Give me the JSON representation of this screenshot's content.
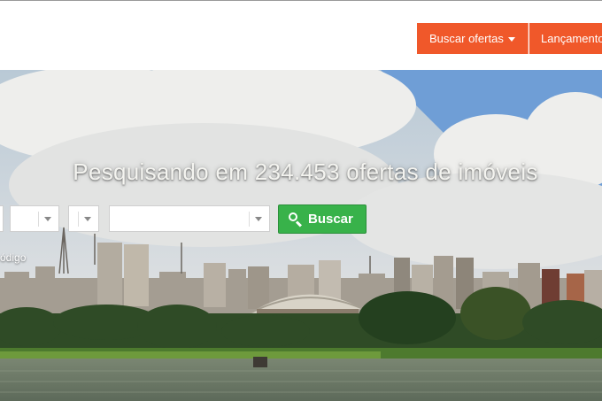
{
  "nav": {
    "buscar_ofertas": "Buscar ofertas",
    "lancamentos": "Lançamento"
  },
  "hero": {
    "headline": "Pesquisando em 234.453 ofertas de imóveis",
    "search_button": "Buscar",
    "codigo_link": "ódigo"
  },
  "colors": {
    "nav_orange": "#f0582a",
    "buscar_green": "#38b24a"
  },
  "icons": [
    "caret-down-icon",
    "search-icon"
  ]
}
